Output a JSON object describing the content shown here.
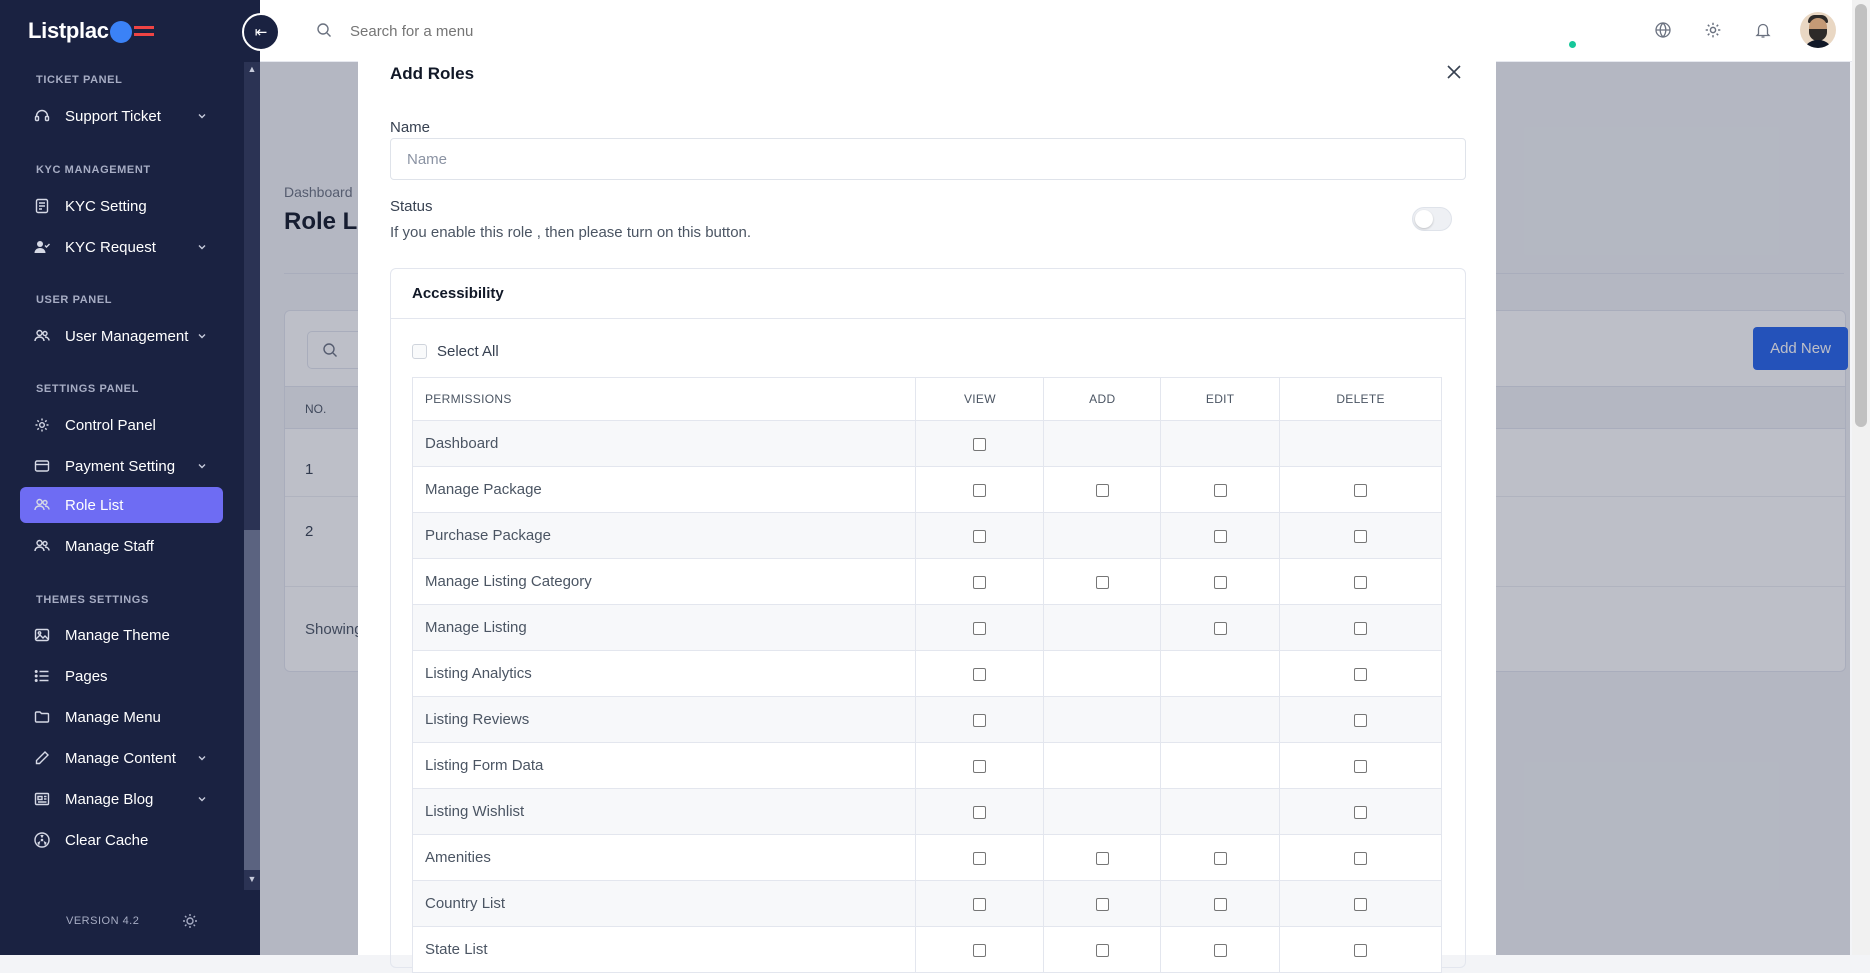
{
  "app": {
    "logo": "Listplac"
  },
  "sidebar": {
    "sections": {
      "ticket": "TICKET PANEL",
      "kyc": "KYC MANAGEMENT",
      "user": "USER PANEL",
      "settings": "SETTINGS PANEL",
      "themes": "THEMES SETTINGS"
    },
    "items": {
      "support_ticket": "Support Ticket",
      "kyc_setting": "KYC Setting",
      "kyc_request": "KYC Request",
      "user_management": "User Management",
      "control_panel": "Control Panel",
      "payment_setting": "Payment Setting",
      "role_list": "Role List",
      "manage_staff": "Manage Staff",
      "manage_theme": "Manage Theme",
      "pages": "Pages",
      "manage_menu": "Manage Menu",
      "manage_content": "Manage Content",
      "manage_blog": "Manage Blog",
      "clear_cache": "Clear Cache"
    },
    "version": "VERSION 4.2"
  },
  "topbar": {
    "search_placeholder": "Search for a menu"
  },
  "background": {
    "breadcrumb": "Dashboard",
    "title": "Role List",
    "add_new": "Add New",
    "table_head_no": "NO.",
    "row_1": "1",
    "row_2": "2",
    "showing": "Showing"
  },
  "modal": {
    "title": "Add Roles",
    "name_label": "Name",
    "name_placeholder": "Name",
    "status_label": "Status",
    "status_help": "If you enable this role , then please turn on this button.",
    "status_on": false,
    "accessibility_title": "Accessibility",
    "select_all": "Select All",
    "columns": [
      "PERMISSIONS",
      "VIEW",
      "ADD",
      "EDIT",
      "DELETE"
    ],
    "permissions": [
      {
        "name": "Dashboard",
        "view": true,
        "add": false,
        "edit": false,
        "delete": false
      },
      {
        "name": "Manage Package",
        "view": true,
        "add": true,
        "edit": true,
        "delete": true
      },
      {
        "name": "Purchase Package",
        "view": true,
        "add": false,
        "edit": true,
        "delete": true
      },
      {
        "name": "Manage Listing Category",
        "view": true,
        "add": true,
        "edit": true,
        "delete": true
      },
      {
        "name": "Manage Listing",
        "view": true,
        "add": false,
        "edit": true,
        "delete": true
      },
      {
        "name": "Listing Analytics",
        "view": true,
        "add": false,
        "edit": false,
        "delete": true
      },
      {
        "name": "Listing Reviews",
        "view": true,
        "add": false,
        "edit": false,
        "delete": true
      },
      {
        "name": "Listing Form Data",
        "view": true,
        "add": false,
        "edit": false,
        "delete": true
      },
      {
        "name": "Listing Wishlist",
        "view": true,
        "add": false,
        "edit": false,
        "delete": true
      },
      {
        "name": "Amenities",
        "view": true,
        "add": true,
        "edit": true,
        "delete": true
      },
      {
        "name": "Country List",
        "view": true,
        "add": true,
        "edit": true,
        "delete": true
      },
      {
        "name": "State List",
        "view": true,
        "add": true,
        "edit": true,
        "delete": true
      }
    ]
  },
  "colors": {
    "sidebar_bg": "#1a2241",
    "active_item": "#6e6cf3",
    "primary_button": "#2563eb"
  }
}
